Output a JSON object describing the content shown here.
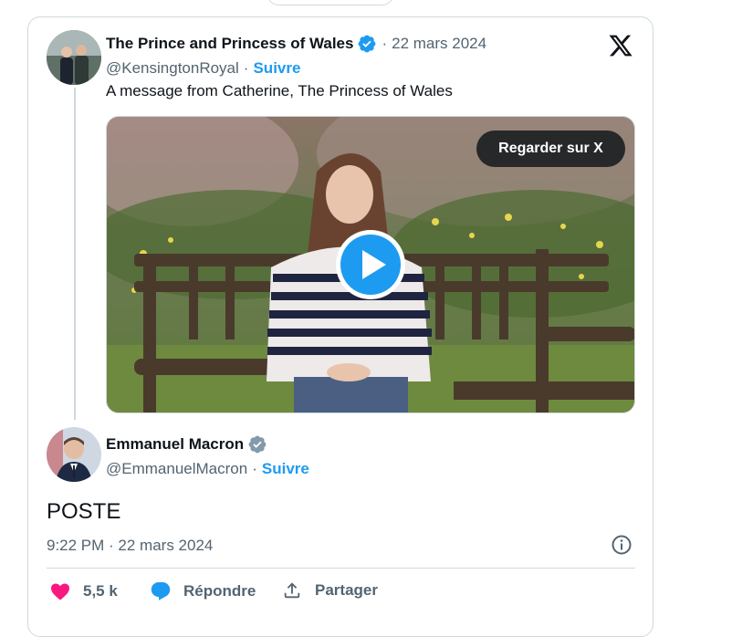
{
  "tweet": {
    "author_name": "The Prince and Princess of Wales",
    "date": "22 mars 2024",
    "handle": "@KensingtonRoyal",
    "follow_label": "Suivre",
    "text": "A message from Catherine, The Princess of Wales",
    "watch_label": "Regarder sur X",
    "separator": "·"
  },
  "reply": {
    "author_name": "Emmanuel Macron",
    "handle": "@EmmanuelMacron",
    "follow_label": "Suivre",
    "text": "POSTE",
    "timestamp": "9:22 PM · 22 mars 2024",
    "separator": "·"
  },
  "actions": {
    "likes": "5,5 k",
    "reply_label": "Répondre",
    "share_label": "Partager"
  },
  "colors": {
    "accent": "#1d9bf0",
    "like": "#f91880",
    "text": "#0f1419",
    "muted": "#536471",
    "border": "#cfd9de"
  },
  "icons": [
    "verified-badge-icon",
    "x-logo-icon",
    "play-icon",
    "info-icon",
    "heart-icon",
    "reply-icon",
    "share-icon"
  ]
}
